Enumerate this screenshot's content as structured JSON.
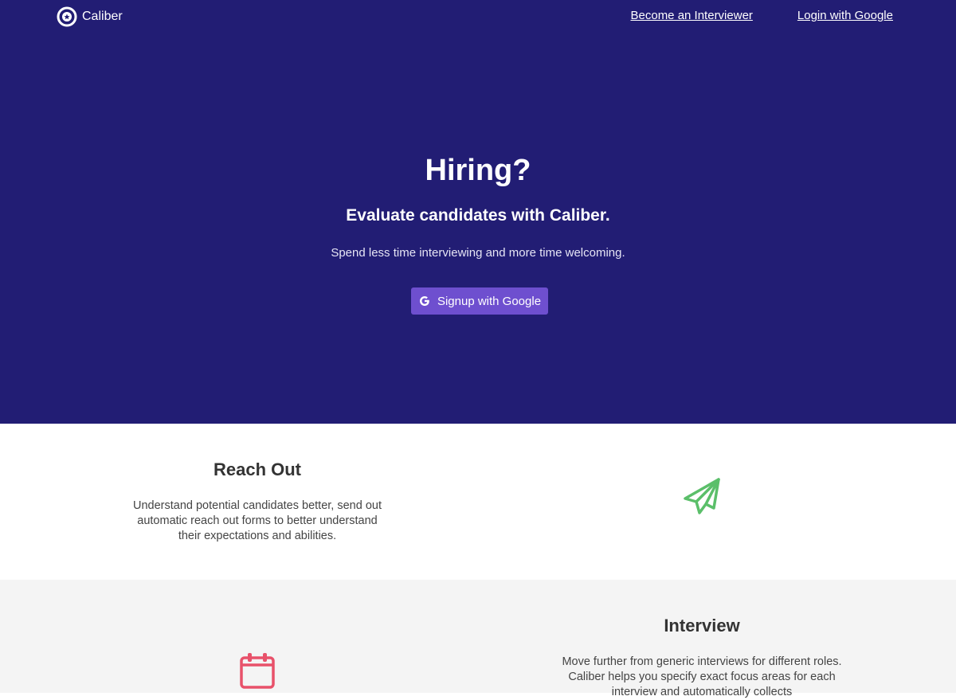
{
  "nav": {
    "brand": "Caliber",
    "links": [
      "Become an Interviewer",
      "Login with Google"
    ]
  },
  "hero": {
    "title": "Hiring?",
    "subtitle": "Evaluate candidates with Caliber.",
    "description": "Spend less time interviewing and more time welcoming.",
    "cta": "Signup with Google"
  },
  "features": [
    {
      "title": "Reach Out",
      "text": "Understand potential candidates better, send out automatic reach out forms to better understand their expectations and abilities.",
      "icon": "paper-plane-icon"
    },
    {
      "title": "Interview",
      "text": "Move further from generic interviews for different roles. Caliber helps you specify exact focus areas for each interview and automatically collects",
      "icon": "calendar-icon"
    }
  ],
  "colors": {
    "hero_bg": "#221d74",
    "button": "#6e4fcf",
    "plane": "#5bbf6a",
    "calendar": "#e8516a"
  }
}
